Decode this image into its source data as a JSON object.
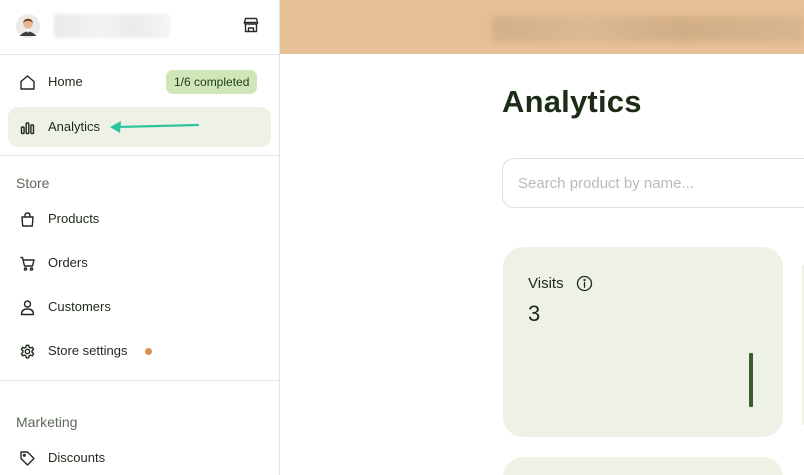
{
  "sidebar": {
    "store_name": "T",
    "nav_top": [
      {
        "label": "Home",
        "icon": "home-icon",
        "badge": "1/6 completed"
      },
      {
        "label": "Analytics",
        "icon": "bar-chart-icon",
        "active": true
      }
    ],
    "store_section": {
      "heading": "Store",
      "items": [
        {
          "label": "Products",
          "icon": "shopping-bag-icon"
        },
        {
          "label": "Orders",
          "icon": "cart-icon"
        },
        {
          "label": "Customers",
          "icon": "user-icon"
        },
        {
          "label": "Store settings",
          "icon": "gear-icon",
          "status_dot_color": "#d9914f"
        }
      ]
    },
    "marketing_section": {
      "heading": "Marketing",
      "items": [
        {
          "label": "Discounts",
          "icon": "tag-icon"
        }
      ]
    }
  },
  "main": {
    "title": "Analytics",
    "search": {
      "placeholder": "Search product by name...",
      "value": ""
    },
    "cards": [
      {
        "title": "Visits",
        "value": "3",
        "info_icon": "info-icon"
      }
    ]
  },
  "colors": {
    "banner": "#e6c095",
    "active_bg": "#eef2e6",
    "badge_bg": "#cfe6b9",
    "accent_arrow": "#2ec4a0",
    "status_dot": "#d9914f",
    "spark_bar": "#3b5b2c"
  }
}
